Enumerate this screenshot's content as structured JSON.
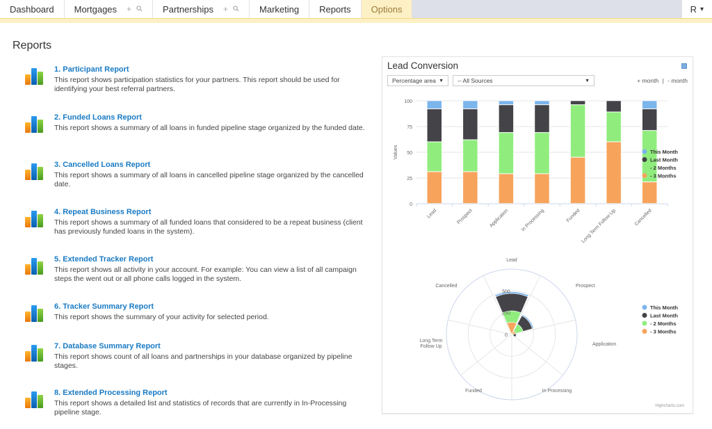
{
  "nav": {
    "tabs": [
      {
        "label": "Dashboard",
        "tools": false,
        "active": false
      },
      {
        "label": "Mortgages",
        "tools": true,
        "active": false
      },
      {
        "label": "Partnerships",
        "tools": true,
        "active": false
      },
      {
        "label": "Marketing",
        "tools": false,
        "active": false
      },
      {
        "label": "Reports",
        "tools": false,
        "active": false
      },
      {
        "label": "Options",
        "tools": false,
        "active": true
      }
    ],
    "add_glyph": "+",
    "search_glyph": "🔍︎",
    "user_label": "R",
    "user_caret": "▾"
  },
  "page_title": "Reports",
  "reports": [
    {
      "title": "1. Participant Report",
      "desc": "This report shows participation statistics for your partners. This report should be used for identifying your best referral partners."
    },
    {
      "title": "2. Funded Loans Report",
      "desc": "This report shows a summary of all loans in funded pipeline stage organized by the funded date."
    },
    {
      "title": "3. Cancelled Loans Report",
      "desc": "This report shows a summary of all loans in cancelled pipeline stage organized by the cancelled date."
    },
    {
      "title": "4. Repeat Business Report",
      "desc": "This report shows a summary of all funded loans that considered to be a repeat business (client has previously funded loans in the system)."
    },
    {
      "title": "5. Extended Tracker Report",
      "desc": "This report shows all activity in your account. For example: You can view a list of all campaign steps the went out or all phone calls logged in the system."
    },
    {
      "title": "6. Tracker Summary Report",
      "desc": "This report shows the summary of your activity for selected period."
    },
    {
      "title": "7. Database Summary Report",
      "desc": "This report shows count of all loans and partnerships in your database organized by pipeline stages."
    },
    {
      "title": "8. Extended Processing Report",
      "desc": "This report shows a detailed list and statistics of records that are currently in In-Processing pipeline stage."
    }
  ],
  "panel": {
    "title": "Lead Conversion",
    "mode_select": "Percentage area",
    "source_select": "-- All Sources",
    "plus_month": "+ month",
    "separator": "|",
    "minus_month": "- month",
    "credit": "Highcharts.com"
  },
  "colors": {
    "this_month": "#7cb5ec",
    "last_month": "#434348",
    "two_months": "#90ed7d",
    "three_months": "#f7a35c",
    "link": "#1a7bc4",
    "active_tab": "#fdf0c4"
  },
  "chart_data": [
    {
      "type": "bar",
      "stacking": "percent",
      "title": "",
      "xlabel": "",
      "ylabel": "Values",
      "ylim": [
        0,
        100
      ],
      "yticks": [
        0,
        25,
        50,
        75,
        100
      ],
      "grid": true,
      "legend": "right",
      "categories": [
        "Lead",
        "Prospect",
        "Application",
        "In Processing",
        "Funded",
        "Long Term Follow Up",
        "Cancelled"
      ],
      "series": [
        {
          "name": "This Month",
          "values": [
            8,
            8,
            4,
            4,
            0,
            0,
            8
          ]
        },
        {
          "name": "Last Month",
          "values": [
            32,
            30,
            27,
            27,
            4,
            11,
            21
          ]
        },
        {
          "name": "- 2 Months",
          "values": [
            29,
            31,
            40,
            40,
            51,
            29,
            50
          ]
        },
        {
          "name": "- 3 Months",
          "values": [
            31,
            31,
            29,
            29,
            45,
            60,
            21
          ]
        }
      ]
    },
    {
      "type": "polar-column",
      "stacking": "normal",
      "title": "",
      "legend": "right",
      "categories": [
        "Lead",
        "Prospect",
        "Application",
        "In Processing",
        "Funded",
        "Long Term Follow Up",
        "Cancelled"
      ],
      "category_labels": [
        "Lead",
        "Prospect",
        "Application",
        "In Processing",
        "Funded",
        "Long Term|Follow Up",
        "Cancelled"
      ],
      "ymax": 750,
      "yticks": [
        0,
        250,
        500
      ],
      "series": [
        {
          "name": "This Month",
          "values": [
            20,
            15,
            0,
            0,
            0,
            0,
            0
          ]
        },
        {
          "name": "Last Month",
          "values": [
            200,
            110,
            30,
            0,
            0,
            0,
            0
          ]
        },
        {
          "name": "- 2 Months",
          "values": [
            130,
            90,
            15,
            0,
            0,
            0,
            0
          ]
        },
        {
          "name": "- 3 Months",
          "values": [
            140,
            45,
            5,
            0,
            0,
            0,
            0
          ]
        }
      ]
    }
  ]
}
